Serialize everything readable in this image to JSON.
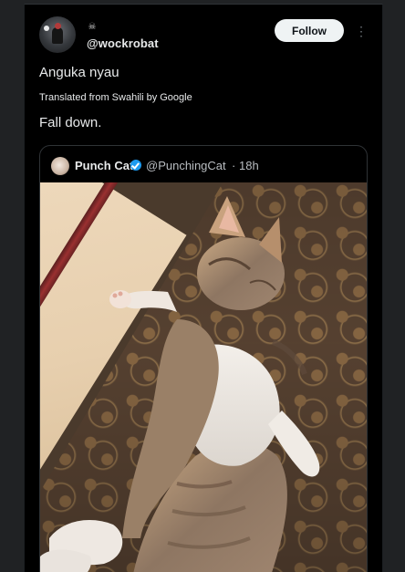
{
  "post": {
    "handle": "@wockrobat",
    "badge_icon": "skull-icon",
    "follow_label": "Follow",
    "more_icon": "more-vertical-icon",
    "original_text": "Anguka nyau",
    "translated_label": "Translated from Swahili by Google",
    "translated_text": "Fall down."
  },
  "quote": {
    "name": "Punch Cat",
    "handle": "@PunchingCat",
    "dot": "·",
    "time": "18h",
    "verified_color": "#1d9bf0",
    "image_description_icon": "kitten-photo"
  },
  "colors": {
    "background": "#000000",
    "page_background": "#202224",
    "text": "#e7e9ea",
    "secondary_text": "#b9bdc1",
    "follow_button_bg": "#eff3f4",
    "follow_button_text": "#0f1419"
  }
}
